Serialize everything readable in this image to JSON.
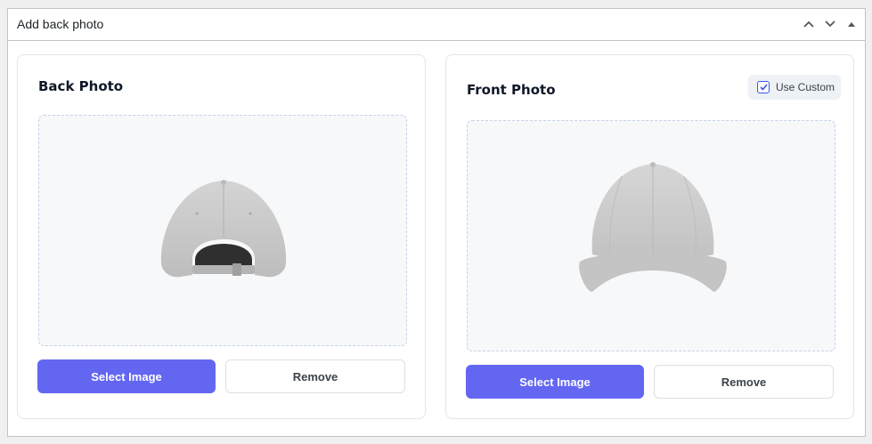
{
  "metabox": {
    "title": "Add back photo",
    "actions": [
      "move-up-icon",
      "move-down-icon",
      "toggle-panel-icon"
    ]
  },
  "back": {
    "title": "Back Photo",
    "image_alt": "Gray baseball cap (back view)",
    "select_label": "Select Image",
    "remove_label": "Remove"
  },
  "front": {
    "title": "Front Photo",
    "use_custom_label": "Use Custom",
    "use_custom_checked": true,
    "image_alt": "Gray baseball cap (front view)",
    "select_label": "Select Image",
    "remove_label": "Remove"
  },
  "colors": {
    "primary": "#6366f1",
    "checkbox": "#3858e9",
    "dropzone_border": "#c5d3e8",
    "cap": "#c9c9c9"
  }
}
